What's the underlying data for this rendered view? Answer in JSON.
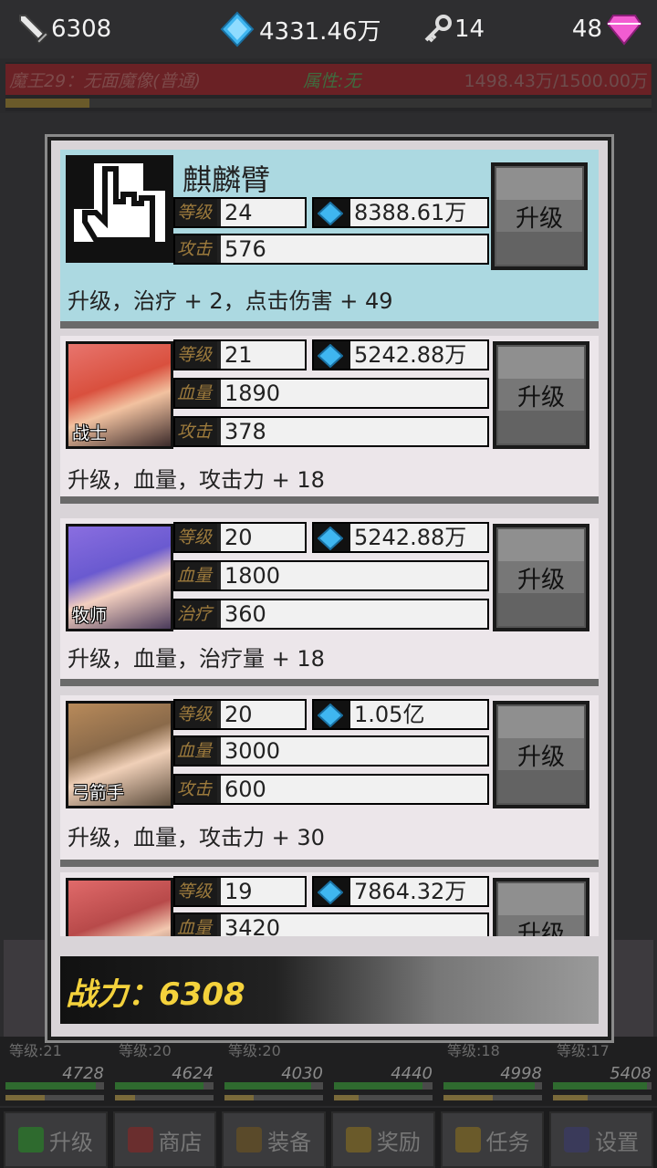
{
  "top": {
    "attack": "6308",
    "diamonds": "4331.46万",
    "keys": "14",
    "gems": "48"
  },
  "boss": {
    "name": "魔王29：无面魔像(普通)",
    "attribute": "属性:无",
    "hp": "1498.43万/1500.00万",
    "hp_fraction": 0.999,
    "progress_fraction": 0.13
  },
  "modal": {
    "upgrade_label": "升级",
    "power_label": "战力：",
    "power_value": "6308",
    "cards": [
      {
        "name": "麒麟臂",
        "level_tag": "等级",
        "level": "24",
        "cost": "8388.61万",
        "stat2_tag": "攻击",
        "stat2": "576",
        "desc": "升级，治疗 + 2，点击伤害 + 49"
      },
      {
        "portrait_label": "战士",
        "level_tag": "等级",
        "level": "21",
        "cost": "5242.88万",
        "stat2_tag": "血量",
        "stat2": "1890",
        "stat3_tag": "攻击",
        "stat3": "378",
        "desc": "升级，血量，攻击力 + 18"
      },
      {
        "portrait_label": "牧师",
        "level_tag": "等级",
        "level": "20",
        "cost": "5242.88万",
        "stat2_tag": "血量",
        "stat2": "1800",
        "stat3_tag": "治疗",
        "stat3": "360",
        "desc": "升级，血量，治疗量 + 18"
      },
      {
        "portrait_label": "弓箭手",
        "level_tag": "等级",
        "level": "20",
        "cost": "1.05亿",
        "stat2_tag": "血量",
        "stat2": "3000",
        "stat3_tag": "攻击",
        "stat3": "600",
        "desc": "升级，血量，攻击力 + 30"
      },
      {
        "level_tag": "等级",
        "level": "19",
        "cost": "7864.32万",
        "stat2_tag": "血量",
        "stat2": "3420"
      }
    ]
  },
  "heroes": [
    {
      "level": "等级:21",
      "hp": "4728",
      "hp_fraction": 0.92,
      "xp_fraction": 0.4
    },
    {
      "level": "等级:20",
      "hp": "4624",
      "hp_fraction": 0.9,
      "xp_fraction": 0.2
    },
    {
      "level": "等级:20",
      "hp": "4030",
      "hp_fraction": 0.88,
      "xp_fraction": 0.3
    },
    {
      "level": "",
      "hp": "4440",
      "hp_fraction": 0.9,
      "xp_fraction": 0.25
    },
    {
      "level": "等级:18",
      "hp": "4998",
      "hp_fraction": 0.93,
      "xp_fraction": 0.5
    },
    {
      "level": "等级:17",
      "hp": "5408",
      "hp_fraction": 0.95,
      "xp_fraction": 0.35
    }
  ],
  "nav": {
    "upgrade": "升级",
    "shop": "商店",
    "equip": "装备",
    "reward": "奖励",
    "quest": "任务",
    "settings": "设置"
  }
}
